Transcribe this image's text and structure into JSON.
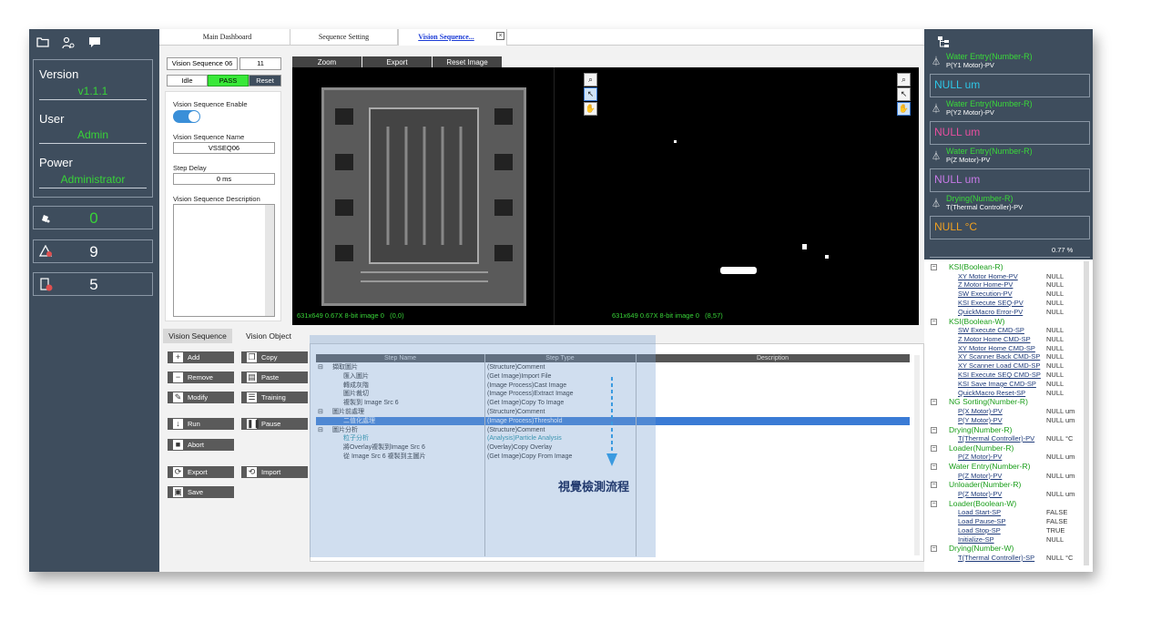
{
  "left_panel": {
    "info": [
      {
        "label": "Version",
        "value": "v1.1.1"
      },
      {
        "label": "User",
        "value": "Admin"
      },
      {
        "label": "Power",
        "value": "Administrator"
      }
    ],
    "counters": [
      {
        "icon": "bell-icon",
        "value": "0"
      },
      {
        "icon": "warning-icon",
        "value": "9"
      },
      {
        "icon": "error-icon",
        "value": "5"
      }
    ]
  },
  "tabs": [
    "Main Dashboard",
    "Sequence Setting",
    "Vision Sequence..."
  ],
  "sequence_config": {
    "name_label": "Vision Sequence 06",
    "index": "11",
    "status_idle": "Idle",
    "status_pass": "PASS",
    "reset_label": "Reset",
    "enable_label": "Vision Sequence Enable",
    "seq_name_label": "Vision Sequence Name",
    "seq_name_value": "VSSEQ06",
    "step_delay_label": "Step Delay",
    "step_delay_value": "0 ms",
    "description_label": "Vision Sequence Description"
  },
  "image_toolbar": [
    "Zoom",
    "Export",
    "Reset Image"
  ],
  "image_info": {
    "left": "631x649 0.67X 8-bit image 0",
    "left_coord": "(0,0)",
    "right": "631x649 0.67X 8-bit image 0",
    "right_coord": "(8,57)"
  },
  "subtabs": [
    "Vision Sequence",
    "Vision Object"
  ],
  "buttons": {
    "add": "Add",
    "copy": "Copy",
    "remove": "Remove",
    "paste": "Paste",
    "modify": "Modify",
    "training": "Training",
    "run": "Run",
    "pause": "Pause",
    "abort": "Abort",
    "export": "Export",
    "import": "Import",
    "save": "Save"
  },
  "grid": {
    "headers": [
      "Step Name",
      "Step Type",
      "Description"
    ],
    "rows": [
      {
        "name": "擷取圖片",
        "type": "(Structure)Comment",
        "indent": 0,
        "group": true
      },
      {
        "name": "匯入圖片",
        "type": "(Get Image)Import File",
        "indent": 1
      },
      {
        "name": "轉成灰階",
        "type": "(Image Process)Cast Image",
        "indent": 1
      },
      {
        "name": "圖片裁切",
        "type": "(Image Process)Extract Image",
        "indent": 1
      },
      {
        "name": "複製到 Image Src 6",
        "type": "(Get Image)Copy To Image",
        "indent": 1
      },
      {
        "name": "圖片前處理",
        "type": "(Structure)Comment",
        "indent": 0,
        "group": true
      },
      {
        "name": "二值化處理",
        "type": "(Image Process)Threshold",
        "indent": 1,
        "selected": true
      },
      {
        "name": "圖片分析",
        "type": "(Structure)Comment",
        "indent": 0,
        "group": true
      },
      {
        "name": "粒子分析",
        "type": "(Analysis)Particle Analysis",
        "indent": 1,
        "link": true
      },
      {
        "name": "將Overlay複製到Image Src 6",
        "type": "(Overlay)Copy Overlay",
        "indent": 1
      },
      {
        "name": "從 Image Src 6 複製到主圖片",
        "type": "(Get Image)Copy From Image",
        "indent": 1
      }
    ],
    "annotation": "視覺檢測流程"
  },
  "right_panel": {
    "monitors": [
      {
        "title": "Water Entry(Number-R)",
        "sub": "P(Y1 Motor)-PV",
        "value": "NULL um",
        "color": "#2ec7e8"
      },
      {
        "title": "Water Entry(Number-R)",
        "sub": "P(Y2 Motor)-PV",
        "value": "NULL um",
        "color": "#e84fa0"
      },
      {
        "title": "Water Entry(Number-R)",
        "sub": "P(Z Motor)-PV",
        "value": "NULL um",
        "color": "#c87ae8"
      },
      {
        "title": "Drying(Number-R)",
        "sub": "T(Thermal Controller)-PV",
        "value": "NULL °C",
        "color": "#f0a020"
      }
    ],
    "progress": "0.77 %",
    "tree": [
      {
        "group": "KSI(Boolean-R)",
        "items": [
          {
            "name": "XY Motor Home-PV",
            "value": "NULL"
          },
          {
            "name": "Z Motor Home-PV",
            "value": "NULL"
          },
          {
            "name": "SW Execution-PV",
            "value": "NULL"
          },
          {
            "name": "KSI Execute SEQ-PV",
            "value": "NULL"
          },
          {
            "name": "QuickMacro Error-PV",
            "value": "NULL"
          }
        ]
      },
      {
        "group": "KSI(Boolean-W)",
        "items": [
          {
            "name": "SW Execute CMD-SP",
            "value": "NULL"
          },
          {
            "name": "Z Motor Home CMD-SP",
            "value": "NULL"
          },
          {
            "name": "XY Motor Home CMD-SP",
            "value": "NULL"
          },
          {
            "name": "XY Scanner Back CMD-SP",
            "value": "NULL"
          },
          {
            "name": "XY Scanner Load CMD-SP",
            "value": "NULL"
          },
          {
            "name": "KSI Execute SEQ CMD-SP",
            "value": "NULL"
          },
          {
            "name": "KSI Save Image CMD-SP",
            "value": "NULL"
          },
          {
            "name": "QuickMacro Reset-SP",
            "value": "NULL"
          }
        ]
      },
      {
        "group": "NG Sorting(Number-R)",
        "items": [
          {
            "name": "P(X Motor)-PV",
            "value": "NULL um"
          },
          {
            "name": "P(Y Motor)-PV",
            "value": "NULL um"
          }
        ]
      },
      {
        "group": "Drying(Number-R)",
        "items": [
          {
            "name": "T(Thermal Controller)-PV",
            "value": "NULL °C"
          }
        ]
      },
      {
        "group": "Loader(Number-R)",
        "items": [
          {
            "name": "P(Z Motor)-PV",
            "value": "NULL um"
          }
        ]
      },
      {
        "group": "Water Entry(Number-R)",
        "items": [
          {
            "name": "P(Z Motor)-PV",
            "value": "NULL um"
          }
        ]
      },
      {
        "group": "Unloader(Number-R)",
        "items": [
          {
            "name": "P(Z Motor)-PV",
            "value": "NULL um"
          }
        ]
      },
      {
        "group": "Loader(Boolean-W)",
        "items": [
          {
            "name": "Load Start-SP",
            "value": "FALSE"
          },
          {
            "name": "Load Pause-SP",
            "value": "FALSE"
          },
          {
            "name": "Load Stop-SP",
            "value": "TRUE"
          },
          {
            "name": "Initialize-SP",
            "value": "NULL"
          }
        ]
      },
      {
        "group": "Drying(Number-W)",
        "items": [
          {
            "name": "T(Thermal Controller)-SP",
            "value": "NULL °C"
          }
        ]
      }
    ]
  }
}
